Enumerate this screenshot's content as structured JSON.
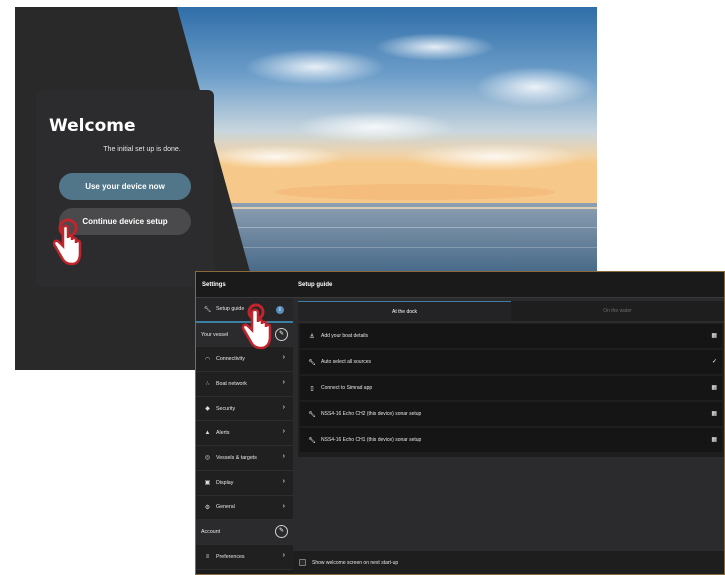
{
  "welcome": {
    "title": "Welcome",
    "subtitle": "The initial set up is done.",
    "primary_button": "Use your device now",
    "secondary_button": "Continue device setup"
  },
  "settings": {
    "sidebar_title": "Settings",
    "main_title": "Setup guide",
    "nav": [
      {
        "label": "Setup guide",
        "icon": "wrench-icon",
        "active": true
      },
      {
        "label": "Your vessel",
        "icon": "edit-icon",
        "section": true
      },
      {
        "label": "Connectivity",
        "icon": "wifi-icon"
      },
      {
        "label": "Boat network",
        "icon": "network-icon"
      },
      {
        "label": "Security",
        "icon": "shield-icon"
      },
      {
        "label": "Alerts",
        "icon": "warning-icon"
      },
      {
        "label": "Vessels & targets",
        "icon": "target-icon"
      },
      {
        "label": "Display",
        "icon": "display-icon"
      },
      {
        "label": "General",
        "icon": "gear-icon"
      },
      {
        "label": "Account",
        "icon": "edit-icon",
        "section": true
      },
      {
        "label": "Preferences",
        "icon": "sliders-icon"
      }
    ],
    "tabs": [
      "At the dock",
      "On the water"
    ],
    "tasks": [
      {
        "label": "Add your boat details",
        "status_icon": "calendar-icon"
      },
      {
        "label": "Auto select all sources",
        "status_icon": "check-icon"
      },
      {
        "label": "Connect to Simrad app",
        "status_icon": "calendar-icon"
      },
      {
        "label": "NSS4-16 Echo CH2 (this device) sonar setup",
        "status_icon": "calendar-icon"
      },
      {
        "label": "NSS4-16 Echo CH1 (this device) sonar setup",
        "status_icon": "calendar-icon"
      }
    ],
    "footer_checkbox_label": "Show welcome screen on next start-up"
  },
  "colors": {
    "primary_button": "#517689",
    "accent": "#3d7fa0",
    "hand_ring": "#c0242c"
  }
}
